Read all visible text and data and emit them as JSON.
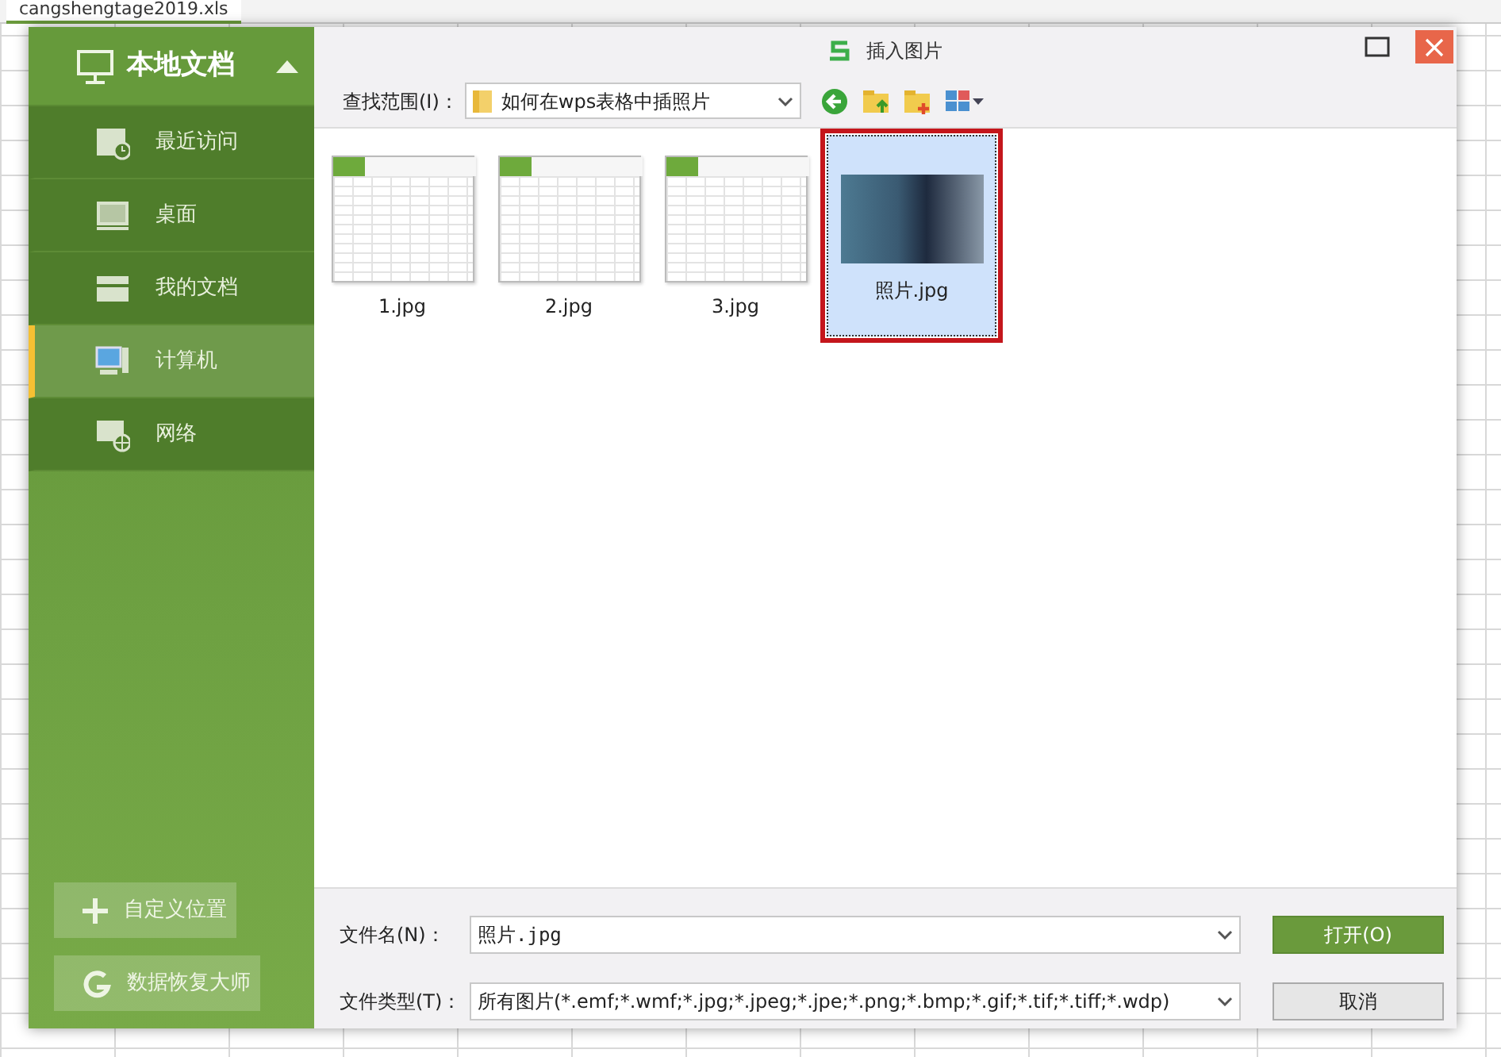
{
  "app_tab": {
    "label": "cangshengtage2019.xls",
    "selected": true
  },
  "dialog": {
    "title": "插入图片"
  },
  "sidebar": {
    "header": "本地文档",
    "expanded": true,
    "items": [
      {
        "label": "最近访问",
        "kind": "recent",
        "selected": false
      },
      {
        "label": "桌面",
        "kind": "desktop",
        "selected": false
      },
      {
        "label": "我的文档",
        "kind": "documents",
        "selected": false
      },
      {
        "label": "计算机",
        "kind": "computer",
        "selected": true
      },
      {
        "label": "网络",
        "kind": "network",
        "selected": false
      }
    ],
    "buttons": [
      {
        "label": "自定义位置",
        "kind": "add"
      },
      {
        "label": "数据恢复大师",
        "kind": "recover"
      }
    ]
  },
  "look_in": {
    "label": "查找范围(I)：",
    "value": "如何在wps表格中插照片"
  },
  "files": [
    {
      "name": "1.jpg",
      "kind": "spreadsheet",
      "selected": false
    },
    {
      "name": "2.jpg",
      "kind": "spreadsheet",
      "selected": false
    },
    {
      "name": "3.jpg",
      "kind": "spreadsheet",
      "selected": false
    },
    {
      "name": "照片.jpg",
      "kind": "photo",
      "selected": true
    }
  ],
  "filename": {
    "label": "文件名(N)：",
    "value": "照片.jpg"
  },
  "filetype": {
    "label": "文件类型(T)：",
    "value": "所有图片(*.emf;*.wmf;*.jpg;*.jpeg;*.jpe;*.png;*.bmp;*.gif;*.tif;*.tiff;*.wdp)"
  },
  "actions": [
    {
      "label": "打开(O)",
      "kind": "primary"
    },
    {
      "label": "取消",
      "kind": "secondary"
    }
  ]
}
